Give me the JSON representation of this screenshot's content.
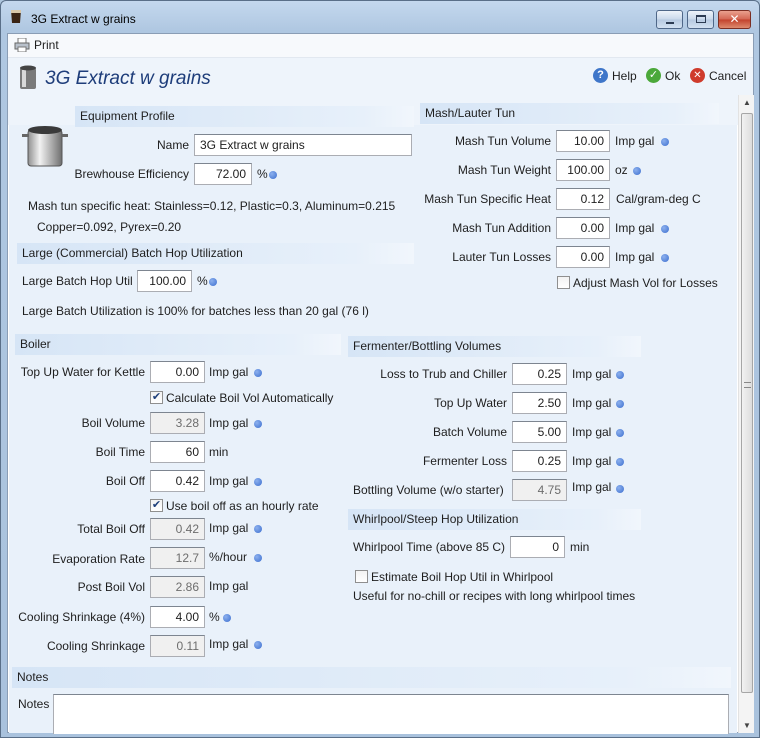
{
  "window": {
    "title": "3G Extract w grains"
  },
  "toolbar": {
    "print_label": "Print"
  },
  "header": {
    "title": "3G Extract w grains",
    "help_label": "Help",
    "ok_label": "Ok",
    "cancel_label": "Cancel"
  },
  "equipment": {
    "section": "Equipment Profile",
    "name_label": "Name",
    "name_value": "3G Extract w grains",
    "efficiency_label": "Brewhouse Efficiency",
    "efficiency_value": "72.00",
    "efficiency_unit": "%",
    "note_line1": "Mash tun specific heat: Stainless=0.12, Plastic=0.3, Aluminum=0.215",
    "note_line2": "Copper=0.092, Pyrex=0.20"
  },
  "large_batch": {
    "section": "Large (Commercial) Batch Hop Utilization",
    "util_label": "Large Batch Hop Util",
    "util_value": "100.00",
    "util_unit": "%",
    "note": "Large Batch Utilization is 100% for batches less than 20 gal (76 l)"
  },
  "mash": {
    "section": "Mash/Lauter Tun",
    "volume_label": "Mash Tun Volume",
    "volume_value": "10.00",
    "volume_unit": "Imp gal",
    "weight_label": "Mash Tun Weight",
    "weight_value": "100.00",
    "weight_unit": "oz",
    "heat_label": "Mash Tun Specific Heat",
    "heat_value": "0.12",
    "heat_unit": "Cal/gram-deg C",
    "addition_label": "Mash Tun Addition",
    "addition_value": "0.00",
    "addition_unit": "Imp gal",
    "lauter_label": "Lauter Tun Losses",
    "lauter_value": "0.00",
    "lauter_unit": "Imp gal",
    "adjust_label": "Adjust Mash Vol for Losses",
    "adjust_checked": false
  },
  "boiler": {
    "section": "Boiler",
    "topup_label": "Top Up Water for Kettle",
    "topup_value": "0.00",
    "topup_unit": "Imp gal",
    "calc_label": "Calculate Boil Vol Automatically",
    "calc_checked": true,
    "boil_vol_label": "Boil Volume",
    "boil_vol_value": "3.28",
    "boil_vol_unit": "Imp gal",
    "boil_time_label": "Boil Time",
    "boil_time_value": "60",
    "boil_time_unit": "min",
    "boil_off_label": "Boil Off",
    "boil_off_value": "0.42",
    "boil_off_unit": "Imp gal",
    "hourly_label": "Use boil off as an hourly rate",
    "hourly_checked": true,
    "total_label": "Total Boil Off",
    "total_value": "0.42",
    "total_unit": "Imp gal",
    "evap_label": "Evaporation Rate",
    "evap_value": "12.7",
    "evap_unit": "%/hour",
    "post_label": "Post Boil Vol",
    "post_value": "2.86",
    "post_unit": "Imp gal",
    "shrink_pct_label": "Cooling Shrinkage (4%)",
    "shrink_pct_value": "4.00",
    "shrink_pct_unit": "%",
    "shrink_label": "Cooling Shrinkage",
    "shrink_value": "0.11",
    "shrink_unit": "Imp gal"
  },
  "fermenter": {
    "section": "Fermenter/Bottling Volumes",
    "trub_label": "Loss to Trub and Chiller",
    "trub_value": "0.25",
    "trub_unit": "Imp gal",
    "topup_label": "Top Up Water",
    "topup_value": "2.50",
    "topup_unit": "Imp gal",
    "batch_label": "Batch Volume",
    "batch_value": "5.00",
    "batch_unit": "Imp gal",
    "loss_label": "Fermenter Loss",
    "loss_value": "0.25",
    "loss_unit": "Imp gal",
    "bottling_label": "Bottling Volume (w/o starter)",
    "bottling_value": "4.75",
    "bottling_unit": "Imp gal"
  },
  "whirlpool": {
    "section": "Whirlpool/Steep Hop Utilization",
    "time_label": "Whirlpool Time (above 85 C)",
    "time_value": "0",
    "time_unit": "min",
    "estimate_label": "Estimate Boil Hop Util in Whirlpool",
    "estimate_checked": false,
    "note": "Useful for no-chill or recipes with long whirlpool times"
  },
  "notes": {
    "section": "Notes",
    "label": "Notes",
    "value": ""
  },
  "colors": {
    "accent": "#1e3d7a",
    "info_dot": "#3c6fcf",
    "section_bg": "#d6e5f6"
  }
}
